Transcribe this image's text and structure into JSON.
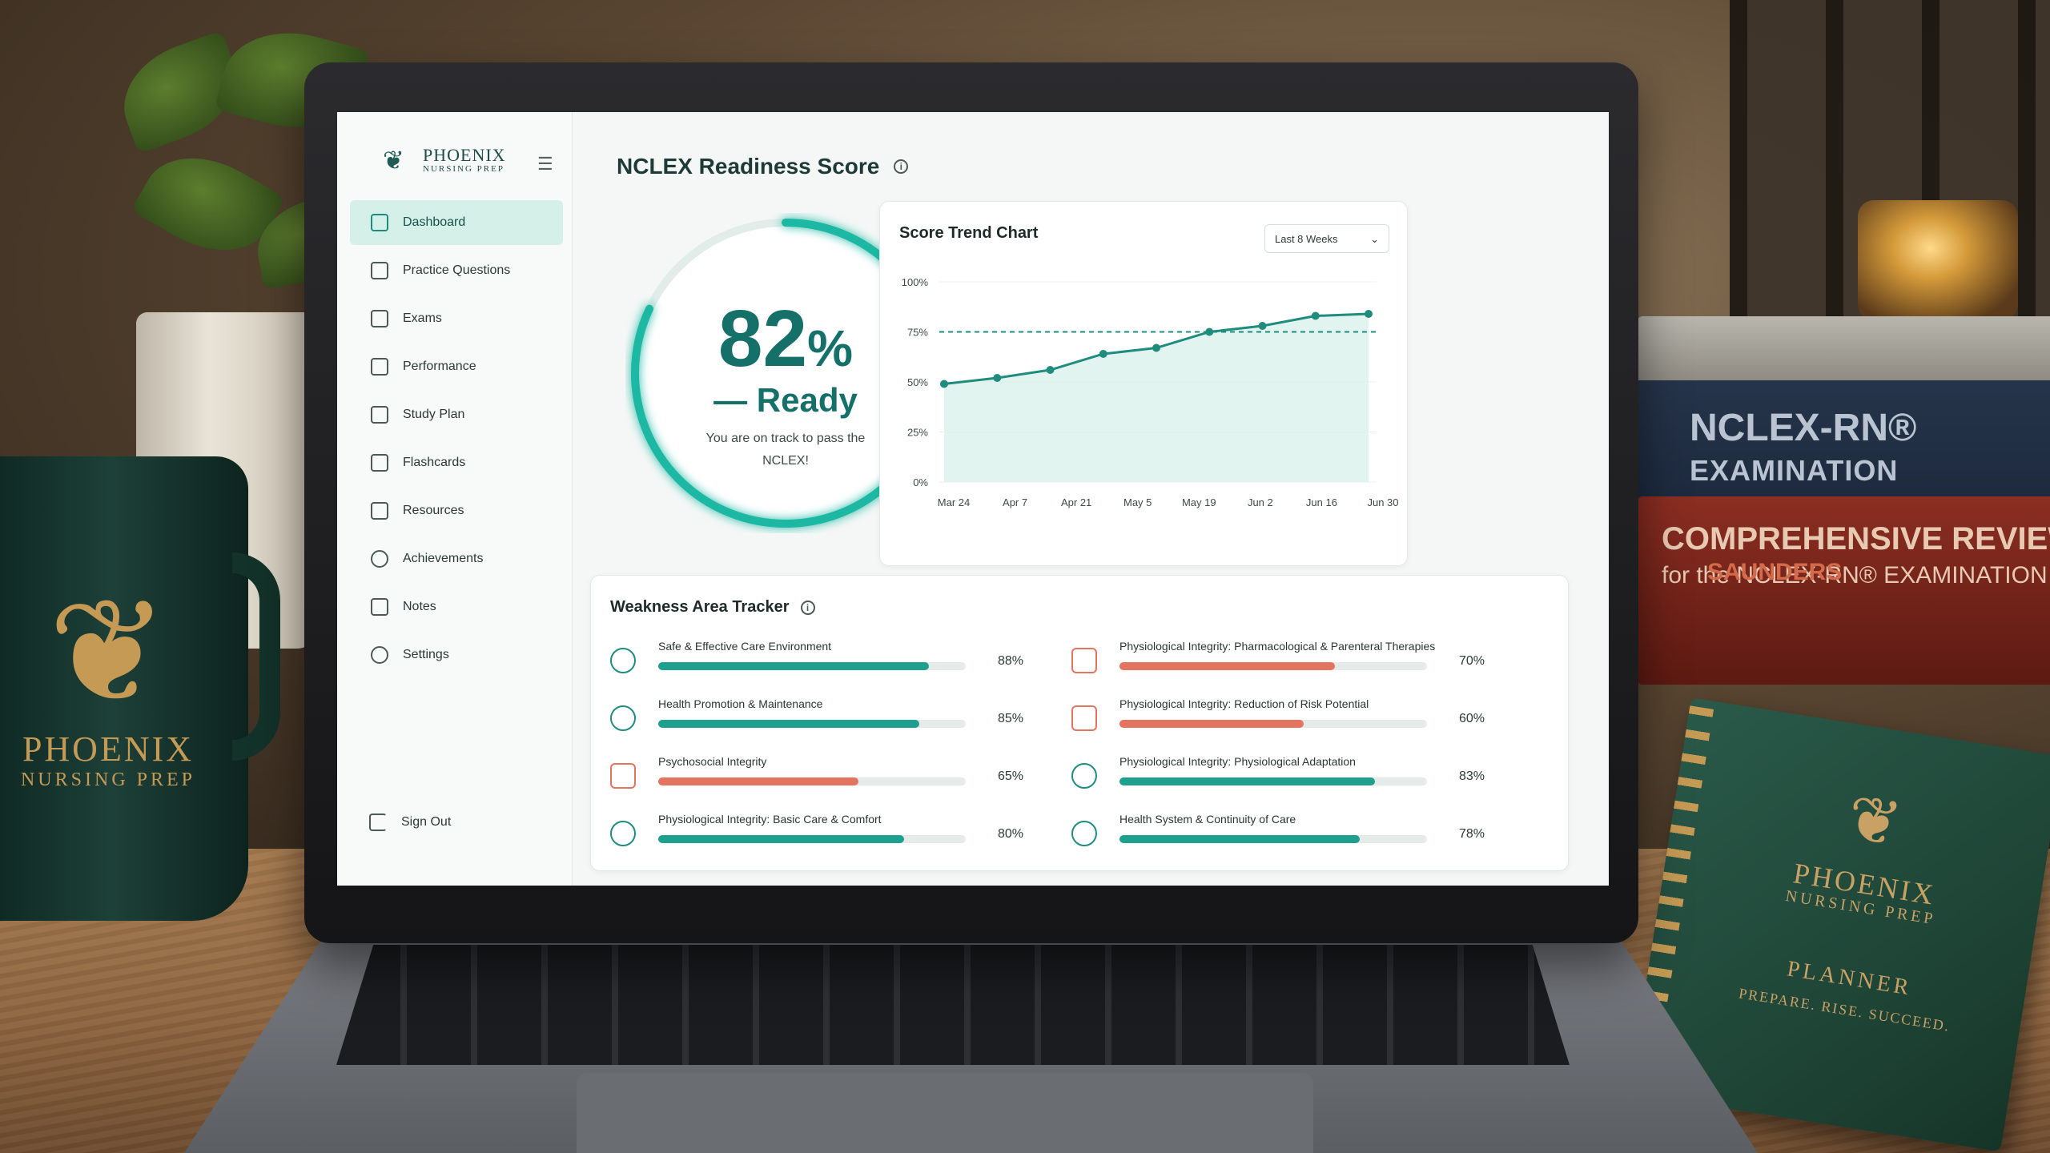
{
  "app": {
    "brand_name": "PHOENIX",
    "brand_sub": "NURSING PREP"
  },
  "sidebar": {
    "items": [
      {
        "label": "Dashboard",
        "icon": "home-icon",
        "active": true
      },
      {
        "label": "Practice Questions",
        "icon": "document-icon"
      },
      {
        "label": "Exams",
        "icon": "calendar-check-icon"
      },
      {
        "label": "Performance",
        "icon": "bar-chart-icon"
      },
      {
        "label": "Study Plan",
        "icon": "calendar-icon"
      },
      {
        "label": "Flashcards",
        "icon": "cards-icon"
      },
      {
        "label": "Resources",
        "icon": "book-icon"
      },
      {
        "label": "Achievements",
        "icon": "award-icon"
      },
      {
        "label": "Notes",
        "icon": "notes-icon"
      },
      {
        "label": "Settings",
        "icon": "gear-icon"
      }
    ],
    "sign_out": "Sign Out"
  },
  "main": {
    "title": "NCLEX Readiness Score",
    "score": {
      "value": "82",
      "unit": "%",
      "state": "— Ready",
      "message": "You are on track to pass the NCLEX!",
      "fraction": 0.82
    }
  },
  "trend": {
    "title": "Score Trend Chart",
    "range_select": "Last 8 Weeks",
    "chart_data": {
      "type": "area",
      "title": "Score Trend Chart",
      "x": [
        "Mar 24",
        "Apr 7",
        "Apr 21",
        "May 5",
        "May 19",
        "Jun 2",
        "Jun 16",
        "Jun 30"
      ],
      "x_ticks": [
        "Mar 24",
        "Apr 7",
        "Apr 21",
        "May 5",
        "May 19",
        "Jun 2",
        "Jun 16",
        "Jun 30"
      ],
      "series": [
        {
          "values": [
            49,
            52,
            56,
            64,
            67,
            75,
            78,
            83,
            84
          ]
        }
      ],
      "point_x": [
        "Mar 24",
        "Mar 31",
        "Apr 14",
        "Apr 28",
        "May 12",
        "May 26",
        "Jun 9",
        "Jun 23",
        "Jun 30"
      ],
      "target_line": 75,
      "y_ticks": [
        "100%",
        "75%",
        "50%",
        "25%",
        "0%"
      ],
      "ylim": [
        0,
        100
      ],
      "grid": true,
      "colors": {
        "line": "#1f8c7d",
        "fill": "#d9f1ec",
        "target": "#1f8c7d"
      }
    }
  },
  "weakness": {
    "title": "Weakness Area Tracker",
    "items": [
      {
        "label": "Safe & Effective Care Environment",
        "value": 88,
        "pct": "88%",
        "tone": "teal",
        "icon": "shield-plus-icon"
      },
      {
        "label": "Health Promotion & Maintenance",
        "value": 85,
        "pct": "85%",
        "tone": "teal",
        "icon": "person-heart-icon"
      },
      {
        "label": "Psychosocial Integrity",
        "value": 65,
        "pct": "65%",
        "tone": "coral",
        "icon": "brain-icon"
      },
      {
        "label": "Physiological Integrity: Basic Care & Comfort",
        "value": 80,
        "pct": "80%",
        "tone": "teal",
        "icon": "care-icon"
      },
      {
        "label": "Physiological Integrity: Pharmacological & Parenteral Therapies",
        "value": 70,
        "pct": "70%",
        "tone": "coral",
        "icon": "pill-icon"
      },
      {
        "label": "Physiological Integrity: Reduction of Risk Potential",
        "value": 60,
        "pct": "60%",
        "tone": "coral",
        "icon": "clipboard-icon"
      },
      {
        "label": "Physiological Integrity: Physiological Adaptation",
        "value": 83,
        "pct": "83%",
        "tone": "teal",
        "icon": "lungs-icon"
      },
      {
        "label": "Health System & Continuity of Care",
        "value": 78,
        "pct": "78%",
        "tone": "teal",
        "icon": "hospital-icon"
      }
    ],
    "colors": {
      "teal": "#1fa08e",
      "coral": "#e4745f"
    }
  },
  "scene": {
    "mug_text_1": "PHOENIX",
    "mug_text_2": "NURSING PREP",
    "book1_title": "NCLEX-RN®",
    "book1_sub": "EXAMINATION",
    "book2_brand": "SAUNDERS",
    "book2_title": "COMPREHENSIVE REVIEW",
    "book2_sub": "for the NCLEX-RN® EXAMINATION",
    "planner_brand_1": "PHOENIX",
    "planner_brand_2": "NURSING PREP",
    "planner_title": "PLANNER",
    "planner_tagline": "PREPARE. RISE. SUCCEED."
  }
}
